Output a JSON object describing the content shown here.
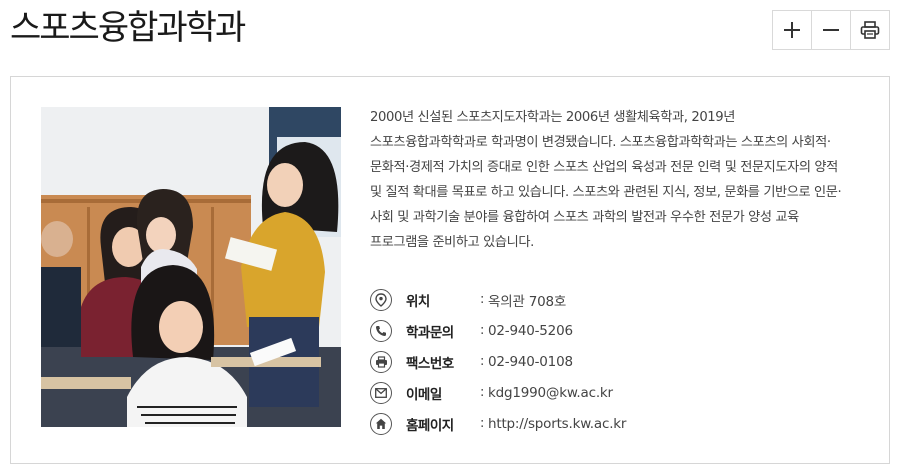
{
  "header": {
    "title": "스포츠융합과학과",
    "toolbar": {
      "zoom_in_icon": "plus-icon",
      "zoom_out_icon": "minus-icon",
      "print_icon": "printer-icon"
    }
  },
  "department": {
    "description_lines": [
      "2000년 신설된 스포츠지도자학과는 2006년 생활체육학과, 2019년",
      "스포츠융합과학학과로 학과명이 변경됐습니다. 스포츠융합과학학과는 스포츠의 사회적·",
      "문화적·경제적 가치의 증대로 인한 스포츠 산업의 육성과 전문 인력 및 전문지도자의 양적",
      "및 질적 확대를 목표로 하고 있습니다. 스포츠와 관련된 지식, 정보, 문화를 기반으로 인문·",
      "사회 및 과학기술 분야를 융합하여 스포츠 과학의 발전과 우수한 전문가 양성 교육",
      "프로그램을 준비하고 있습니다."
    ],
    "info": [
      {
        "icon": "location-pin-icon",
        "label": "위치",
        "separator": ":",
        "value": "옥의관 708호"
      },
      {
        "icon": "phone-icon",
        "label": "학과문의",
        "separator": ":",
        "value": "02-940-5206"
      },
      {
        "icon": "fax-icon",
        "label": "팩스번호",
        "separator": ":",
        "value": "02-940-0108"
      },
      {
        "icon": "email-icon",
        "label": "이메일",
        "separator": ":",
        "value": "kdg1990@kw.ac.kr"
      },
      {
        "icon": "home-icon",
        "label": "홈페이지",
        "separator": ":",
        "value": "http://sports.kw.ac.kr"
      }
    ]
  },
  "colors": {
    "border": "#d6d6d6",
    "text": "#444444",
    "title": "#1a1a1a"
  }
}
